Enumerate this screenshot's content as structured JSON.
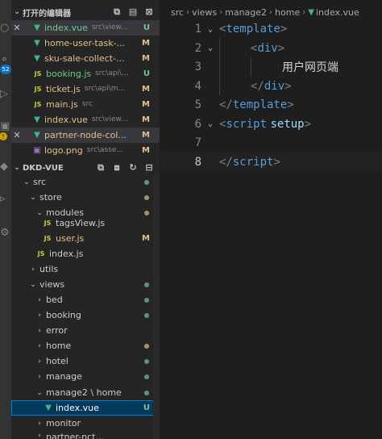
{
  "sidebar": {
    "open_editors_title": "打开的编辑器",
    "explorer_title": "DKD-VUE",
    "open_editors": [
      {
        "name": "index.vue",
        "path": "src\\view...",
        "status": "U",
        "type": "vue",
        "closable": true
      },
      {
        "name": "home-user-task-...",
        "path": "",
        "status": "M",
        "type": "vue"
      },
      {
        "name": "sku-sale-collect-...",
        "path": "",
        "status": "M",
        "type": "vue"
      },
      {
        "name": "booking.js",
        "path": "src\\api\\...",
        "status": "U",
        "type": "js"
      },
      {
        "name": "ticket.js",
        "path": "src\\api\\m...",
        "status": "M",
        "type": "js"
      },
      {
        "name": "main.js",
        "path": "src",
        "status": "M",
        "type": "js"
      },
      {
        "name": "index.vue",
        "path": "src\\view...",
        "status": "M",
        "type": "vue"
      },
      {
        "name": "partner-node-col...",
        "path": "",
        "status": "M",
        "type": "vue",
        "closable": true
      },
      {
        "name": "logo.png",
        "path": "src\\asse...",
        "status": "M",
        "type": "img"
      }
    ],
    "tree": {
      "src": "src",
      "store": "store",
      "modules": "modules",
      "tagsView": "tagsView.js",
      "user": "user.js",
      "user_status": "M",
      "store_index": "index.js",
      "utils": "utils",
      "views": "views",
      "folders": [
        "bed",
        "booking",
        "error",
        "home",
        "hotel",
        "manage"
      ],
      "manage2_home": "manage2 \\ home",
      "active_file": "index.vue",
      "active_status": "U",
      "monitor": "monitor",
      "last_partial": "partner-nct..."
    }
  },
  "activity": {
    "badge": "52"
  },
  "editor": {
    "breadcrumb": [
      "src",
      "views",
      "manage2",
      "home",
      "index.vue"
    ],
    "lines": [
      {
        "n": "1",
        "indent": 0,
        "parts": [
          [
            "br",
            "<"
          ],
          [
            "tag",
            "template"
          ],
          [
            "br",
            ">"
          ]
        ]
      },
      {
        "n": "2",
        "indent": 1,
        "parts": [
          [
            "br",
            "<"
          ],
          [
            "tag",
            "div"
          ],
          [
            "br",
            ">"
          ]
        ]
      },
      {
        "n": "3",
        "indent": 2,
        "parts": [
          [
            "text",
            "用户网页端"
          ]
        ]
      },
      {
        "n": "4",
        "indent": 1,
        "parts": [
          [
            "br",
            "</"
          ],
          [
            "tag",
            "div"
          ],
          [
            "br",
            ">"
          ]
        ]
      },
      {
        "n": "5",
        "indent": 0,
        "parts": [
          [
            "br",
            "</"
          ],
          [
            "tag",
            "template"
          ],
          [
            "br",
            ">"
          ]
        ]
      },
      {
        "n": "6",
        "indent": 0,
        "parts": [
          [
            "br",
            "<"
          ],
          [
            "tag",
            "script"
          ],
          [
            "text",
            " "
          ],
          [
            "attr",
            "setup"
          ],
          [
            "br",
            ">"
          ]
        ]
      },
      {
        "n": "7",
        "indent": 0,
        "parts": []
      },
      {
        "n": "8",
        "indent": 0,
        "parts": [
          [
            "br",
            "</"
          ],
          [
            "tag",
            "script"
          ],
          [
            "br",
            ">"
          ]
        ]
      }
    ],
    "current_line": "8"
  }
}
